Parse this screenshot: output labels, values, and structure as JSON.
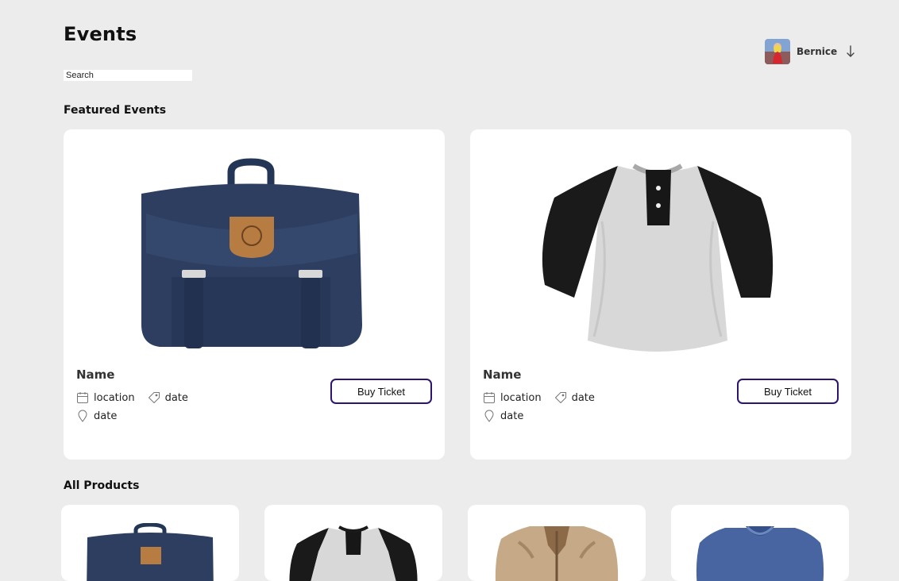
{
  "page": {
    "title": "Events"
  },
  "search": {
    "placeholder": "Search",
    "value": ""
  },
  "user": {
    "name": "Bernice",
    "avatar_icon": "avatar-image",
    "dropdown_icon": "arrow-down-icon"
  },
  "featured": {
    "heading": "Featured Events",
    "cards": [
      {
        "name": "Name",
        "location": "location",
        "date_tag": "date",
        "date_pin": "date",
        "image": "backpack-image",
        "button_label": "Buy Ticket"
      },
      {
        "name": "Name",
        "location": "location",
        "date_tag": "date",
        "date_pin": "date",
        "image": "henley-shirt-image",
        "button_label": "Buy Ticket"
      }
    ]
  },
  "products": {
    "heading": "All Products",
    "items": [
      {
        "image": "backpack-image"
      },
      {
        "image": "henley-shirt-image"
      },
      {
        "image": "jacket-image"
      },
      {
        "image": "blue-shirt-image"
      }
    ]
  },
  "colors": {
    "background": "#ececec",
    "card": "#ffffff",
    "accent": "#2c1471",
    "text": "#111111",
    "backpack": "#2d3e60",
    "shirt_gray": "#d8d8d8",
    "shirt_black": "#1a1a1a",
    "jacket": "#c6a986",
    "blue_shirt": "#4865a1"
  }
}
